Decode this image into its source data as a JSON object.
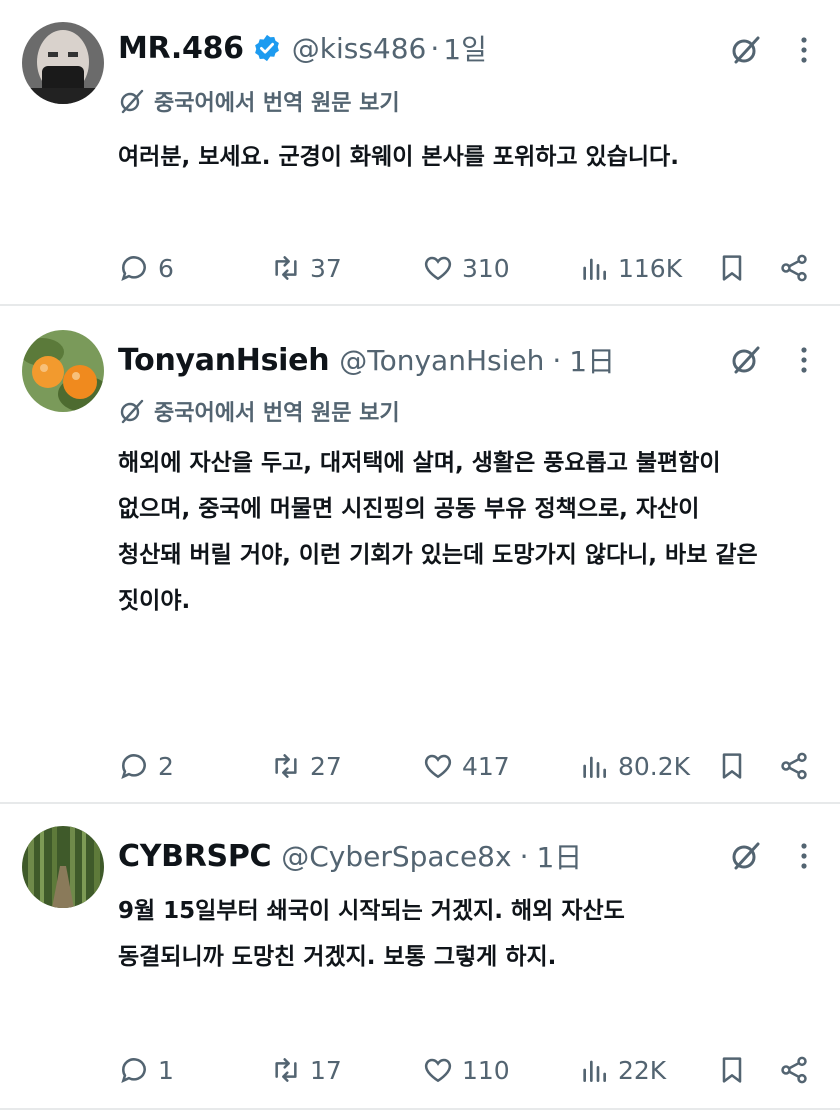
{
  "tweets": [
    {
      "name": "MR.486",
      "verified": true,
      "handle": "@kiss486",
      "sep": "·",
      "time": "1일",
      "translate_label": "중국어에서 번역 원문 보기",
      "body": "여러분, 보세요. 군경이 화웨이 본사를 포위하고 있습니다.",
      "replies": "6",
      "reposts": "37",
      "likes": "310",
      "views": "116K"
    },
    {
      "name": "TonyanHsieh",
      "verified": false,
      "handle": "@TonyanHsieh",
      "sep": "·",
      "time": "1日",
      "translate_label": "중국어에서 번역 원문 보기",
      "body_lines": [
        "해외에 자산을 두고, 대저택에 살며, 생활은 풍요롭고 불편함이",
        "없으며, 중국에 머물면 시진핑의 공동 부유 정책으로, 자산이",
        "청산돼 버릴 거야, 이런 기회가 있는데 도망가지 않다니, 바보 같은",
        "짓이야."
      ],
      "replies": "2",
      "reposts": "27",
      "likes": "417",
      "views": "80.2K"
    },
    {
      "name": "CYBRSPC",
      "verified": false,
      "handle": "@CyberSpace8x",
      "sep": "·",
      "time": "1日",
      "body_lines": [
        "9월 15일부터 쇄국이 시작되는 거겠지. 해외 자산도",
        "동결되니까 도망친 거겠지. 보통 그렇게 하지."
      ],
      "replies": "1",
      "reposts": "17",
      "likes": "110",
      "views": "22K"
    }
  ],
  "icons": {
    "reply": "reply-icon",
    "repost": "repost-icon",
    "like": "heart-icon",
    "views": "views-icon",
    "bookmark": "bookmark-icon",
    "share": "share-icon",
    "grok": "grok-icon",
    "more": "more-icon",
    "translate": "translate-icon",
    "verified": "verified-badge-icon"
  },
  "colors": {
    "text": "#0f1419",
    "secondary": "#536471",
    "verified": "#1d9bf0",
    "divider": "#e7e9ea"
  }
}
